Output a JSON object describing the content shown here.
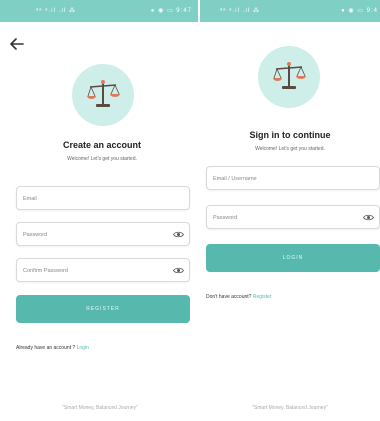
{
  "colors": {
    "accent": "#57b9ad",
    "status_bar": "#7fcfc4",
    "logo_bg": "#cdeee9"
  },
  "register": {
    "status": {
      "left": "ᵃᵃ ᵃ.ıl .ıl ⁂",
      "right": "● ◉ ▭ 9:47"
    },
    "title": "Create an account",
    "subtitle": "Welcome! Let's get you started.",
    "email_placeholder": "Email",
    "password_placeholder": "Password",
    "confirm_placeholder": "Confirm Password",
    "button": "REGISTER",
    "alt_text": "Already have an account ? ",
    "alt_link": "Login",
    "footer": "\"Smart Money, Balanced Journey\""
  },
  "login": {
    "status": {
      "left": "ᵃᵃ ᵃ.ıl .ıl ⁂",
      "right": "● ◉ ▭ 9:4"
    },
    "title": "Sign in to continue",
    "subtitle": "Welcome! Let's get you started.",
    "username_placeholder": "Email / Username",
    "password_placeholder": "Password",
    "button": "LOGIN",
    "alt_text": "Don't have account? ",
    "alt_link": "Register",
    "footer": "\"Smart Money, Balanced Journey\""
  }
}
